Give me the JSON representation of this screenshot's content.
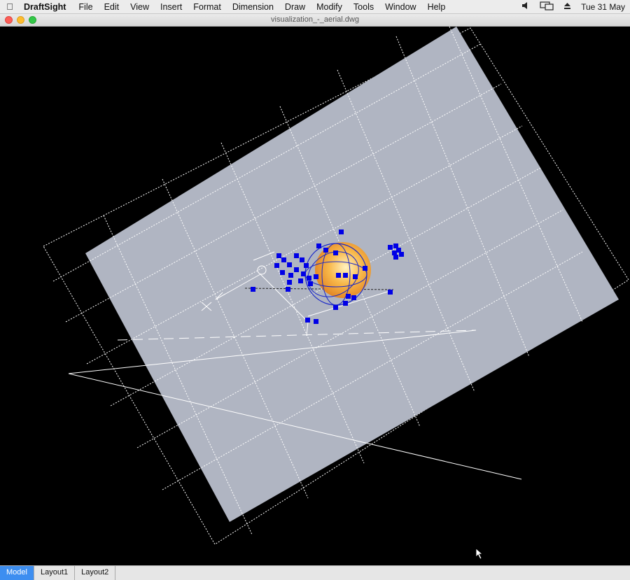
{
  "menubar": {
    "app_name": "DraftSight",
    "items": [
      "File",
      "Edit",
      "View",
      "Insert",
      "Format",
      "Dimension",
      "Draw",
      "Modify",
      "Tools",
      "Window",
      "Help"
    ],
    "date": "Tue 31 May"
  },
  "window": {
    "title": "visualization_-_aerial.dwg"
  },
  "tabs": [
    {
      "label": "Model",
      "active": true
    },
    {
      "label": "Layout1",
      "active": false
    },
    {
      "label": "Layout2",
      "active": false
    }
  ],
  "colors": {
    "canvas_bg": "#000000",
    "ground_plane": "#b0b5c2",
    "grip": "#0000e6",
    "sun_orange": "#f0a030",
    "active_tab": "#3d8ef0"
  },
  "icons": [
    "apple-icon",
    "volume-icon",
    "display-icon",
    "eject-icon",
    "cursor-icon"
  ]
}
